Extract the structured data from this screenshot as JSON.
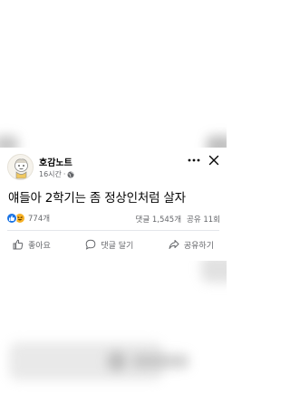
{
  "post": {
    "author": "호감노트",
    "time": "16시간",
    "visibility_icon": "globe-icon",
    "text": "얘들아 2학기는 좀 정상인처럼 살자"
  },
  "reactions": {
    "types": [
      "like",
      "haha"
    ],
    "count": "774개"
  },
  "stats": {
    "comments": "댓글 1,545개",
    "shares": "공유 11회"
  },
  "actions": {
    "like": "좋아요",
    "comment": "댓글 달기",
    "share": "공유하기"
  },
  "colors": {
    "like_blue": "#1b74e4",
    "haha_yellow": "#f7b125",
    "secondary_text": "#65676b",
    "primary_text": "#050505"
  }
}
